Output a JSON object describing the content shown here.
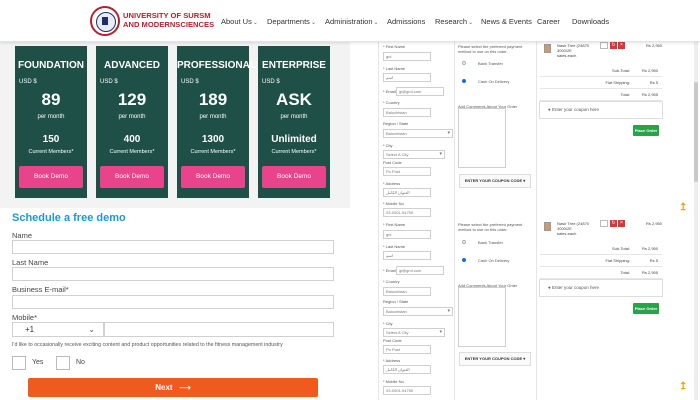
{
  "header": {
    "logo_line1": "UNIVERSITY OF SURSM",
    "logo_line2": "AND MODERNSCIENCES",
    "nav": [
      {
        "label": "About Us",
        "caret": true
      },
      {
        "label": "Departments",
        "caret": true
      },
      {
        "label": "Administration",
        "caret": true
      },
      {
        "label": "Admissions",
        "caret": false
      },
      {
        "label": "Research",
        "caret": true
      },
      {
        "label": "News & Events",
        "caret": false
      },
      {
        "label": "Career",
        "caret": false
      },
      {
        "label": "Downloads",
        "caret": false
      }
    ]
  },
  "pricing": {
    "currency": "USD $",
    "per_label": "per month",
    "members_label": "Current Members*",
    "cta_label": "Book Demo",
    "plans": [
      {
        "tier": "FOUNDATION",
        "price": "89",
        "members": "150"
      },
      {
        "tier": "ADVANCED",
        "price": "129",
        "members": "400"
      },
      {
        "tier": "PROFESSIONAL",
        "price": "189",
        "members": "1300"
      },
      {
        "tier": "ENTERPRISE",
        "price": "ASK",
        "members": "Unlimited"
      }
    ]
  },
  "demo_form": {
    "title": "Schedule a free demo",
    "name_label": "Name",
    "last_name_label": "Last Name",
    "email_label": "Business E-mail*",
    "mobile_label": "Mobile*",
    "country_code": "+1",
    "consent_text": "I'd like to occasionally receive exciting content and product opportunities related to the fitness management industry",
    "yes_label": "Yes",
    "no_label": "No",
    "next_label": "Next"
  },
  "checkout": {
    "first_name_label": "* First Name",
    "first_name_value": "gnl",
    "last_name_label": "* Last Name",
    "last_name_placeholder": "اسم",
    "email_label": "* Email",
    "email_value": "gl@gml.com",
    "country_label": "* Country",
    "country_value": "Balochistan",
    "region_label": "Region / State",
    "region_value": "Balochistan",
    "city_label": "* City",
    "city_placeholder": "Select A City",
    "postcode_label": "Post Code",
    "postcode_placeholder": "Po Post",
    "address_label": "* Address",
    "address_placeholder": "العنوان الكامل",
    "mobile_label": "* Mobile No",
    "mobile_value": "03-0001-94755",
    "payment_prompt": "Please select the preferred payment method to use on this order.",
    "bank_transfer": "Bank Transfer",
    "cash_on_delivery": "Cash On Delivery",
    "comments_label": "Add Comments About Your Order",
    "coupon_button": "ENTER YOUR COUPON CODE ▾",
    "product_line1": "Nasir Tree (24870",
    "product_line2": "3000/2E",
    "product_line3": "sales-each",
    "product_price": "Rs 2,950",
    "subtotal_label": "Sub-Total:",
    "subtotal_value": "Rs 2,950",
    "shipping_label": "Flat Shipping:",
    "shipping_value": "Rs 5",
    "total_label": "Total:",
    "total_value": "Rs 2,955",
    "coupon_placeholder": "● Enter your coupon here",
    "place_order": "Place Order"
  },
  "colors": {
    "card_bg": "#1f5047",
    "book_demo": "#e8438b",
    "title_blue": "#1a9ad6",
    "next_orange": "#f05a1e",
    "place_order_green": "#27a348",
    "brand_red": "#b5222e"
  }
}
